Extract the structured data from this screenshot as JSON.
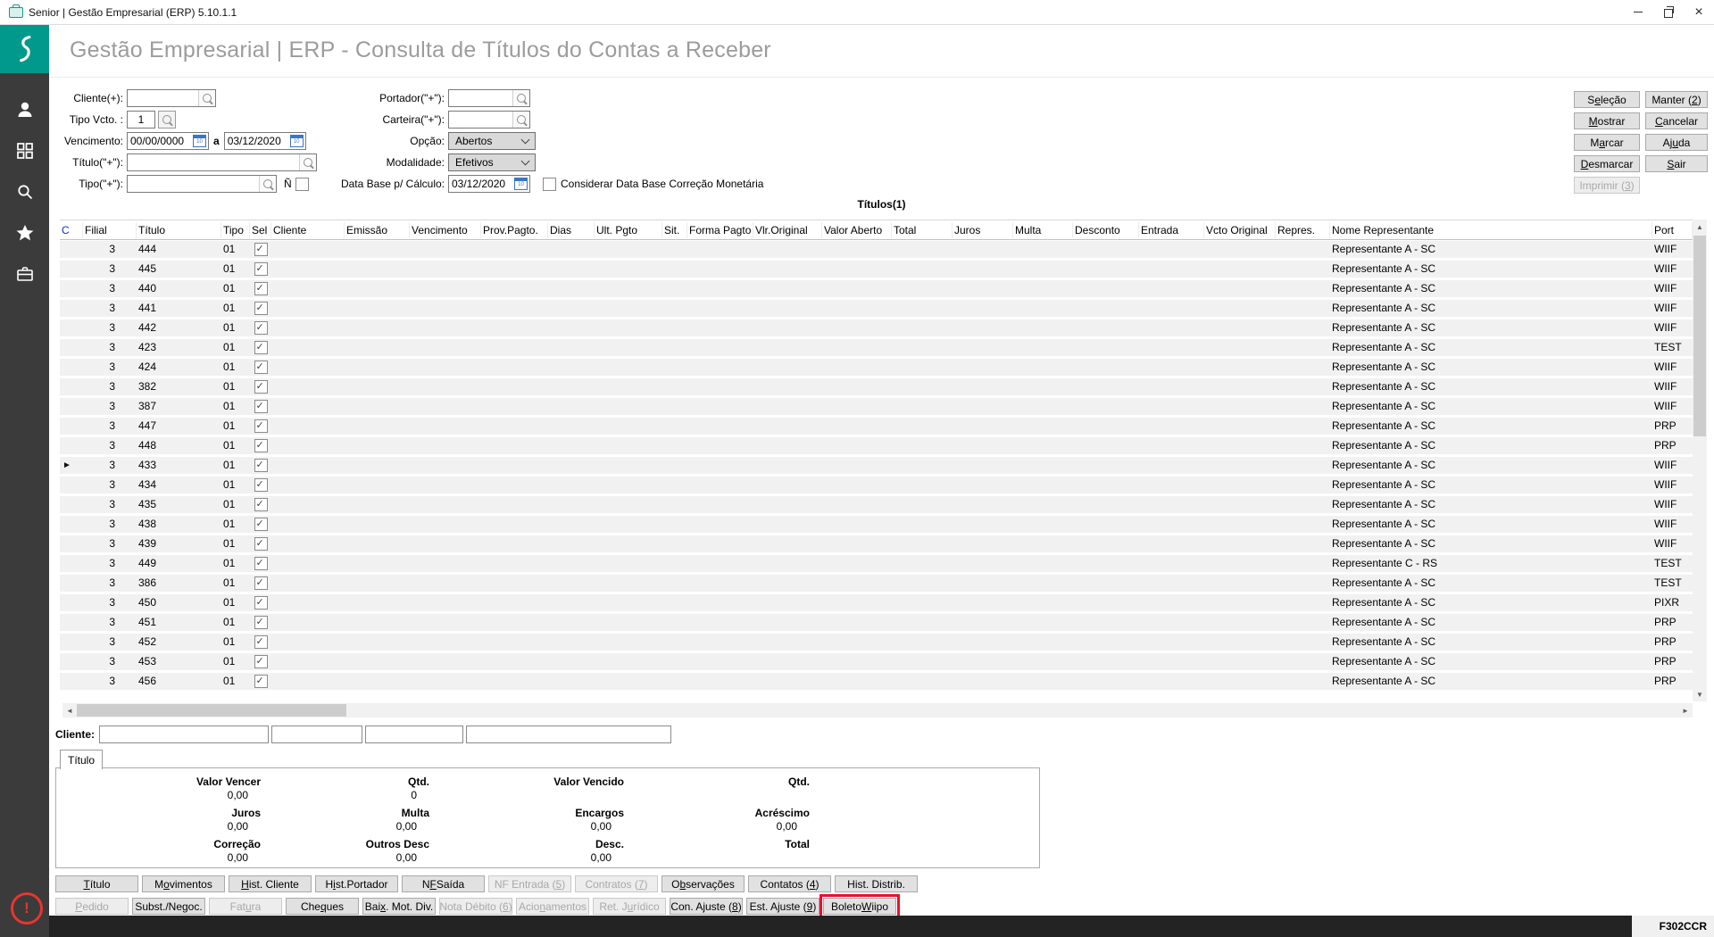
{
  "window": {
    "title": "Senior | Gestão Empresarial (ERP) 5.10.1.1",
    "controls": [
      "minimize-icon",
      "restore-icon",
      "close-icon"
    ]
  },
  "sidebar": {
    "brand_icon": "senior-logo",
    "icons": [
      "user",
      "apps-grid",
      "search",
      "star",
      "briefcase"
    ],
    "alert": "!"
  },
  "header": {
    "title": "Gestão Empresarial | ERP - Consulta de Títulos do Contas a Receber"
  },
  "filters": {
    "cliente_label": "Cliente(+):",
    "tipo_vcto_label": "Tipo Vcto. :",
    "tipo_vcto_value": "1",
    "vencimento_label": "Vencimento:",
    "vencimento_from": "00/00/0000",
    "range_sep": "a",
    "vencimento_to": "03/12/2020",
    "titulo_label": "Título(\"+\"):",
    "tipo_label": "Tipo(\"+\"):",
    "n_label": "Ñ",
    "portador_label": "Portador(\"+\"):",
    "carteira_label": "Carteira(\"+\"):",
    "opcao_label": "Opção:",
    "opcao_value": "Abertos",
    "modalidade_label": "Modalidade:",
    "modalidade_value": "Efetivos",
    "database_label": "Data Base p/ Cálculo:",
    "database_value": "03/12/2020",
    "considerar_label": "Considerar Data Base Correção Monetária"
  },
  "right_buttons": [
    {
      "html": "S<u>e</u>leção"
    },
    {
      "html": "Manter (<u>2</u>)"
    },
    {
      "html": "<u>M</u>ostrar"
    },
    {
      "html": "<u>C</u>ancelar"
    },
    {
      "html": "M<u>a</u>rcar"
    },
    {
      "html": "Aj<u>u</u>da"
    },
    {
      "html": "<u>D</u>esmarcar"
    },
    {
      "html": "<u>S</u>air"
    },
    {
      "html": "Imprimir (<u>3</u>)",
      "disabled": true
    }
  ],
  "caption": "Títulos(1)",
  "table": {
    "headers": [
      {
        "label": "C",
        "cls": "hl"
      },
      {
        "label": "Filial"
      },
      {
        "label": "Título"
      },
      {
        "label": "Tipo"
      },
      {
        "label": "Sel"
      },
      {
        "label": "Cliente"
      },
      {
        "label": "Emissão"
      },
      {
        "label": "Vencimento"
      },
      {
        "label": "Prov.Pagto."
      },
      {
        "label": "Dias"
      },
      {
        "label": "Ult. Pgto"
      },
      {
        "label": "Sit."
      },
      {
        "label": "Forma Pagto"
      },
      {
        "label": "Vlr.Original"
      },
      {
        "label": "Valor Aberto"
      },
      {
        "label": "Total"
      },
      {
        "label": "Juros"
      },
      {
        "label": "Multa"
      },
      {
        "label": "Desconto"
      },
      {
        "label": "Entrada"
      },
      {
        "label": "Vcto Original"
      },
      {
        "label": "Repres."
      },
      {
        "label": "Nome Representante"
      },
      {
        "label": "Port"
      }
    ],
    "rows": [
      {
        "filial": "3",
        "titulo": "444",
        "tipo": "01",
        "checked": true,
        "nome": "Representante A - SC",
        "port": "WIIF"
      },
      {
        "filial": "3",
        "titulo": "445",
        "tipo": "01",
        "checked": true,
        "nome": "Representante A - SC",
        "port": "WIIF"
      },
      {
        "filial": "3",
        "titulo": "440",
        "tipo": "01",
        "checked": true,
        "nome": "Representante A - SC",
        "port": "WIIF"
      },
      {
        "filial": "3",
        "titulo": "441",
        "tipo": "01",
        "checked": true,
        "nome": "Representante A - SC",
        "port": "WIIF"
      },
      {
        "filial": "3",
        "titulo": "442",
        "tipo": "01",
        "checked": true,
        "nome": "Representante A - SC",
        "port": "WIIF"
      },
      {
        "filial": "3",
        "titulo": "423",
        "tipo": "01",
        "checked": true,
        "nome": "Representante A - SC",
        "port": "TEST"
      },
      {
        "filial": "3",
        "titulo": "424",
        "tipo": "01",
        "checked": true,
        "nome": "Representante A - SC",
        "port": "WIIF"
      },
      {
        "filial": "3",
        "titulo": "382",
        "tipo": "01",
        "checked": true,
        "nome": "Representante A - SC",
        "port": "WIIF"
      },
      {
        "filial": "3",
        "titulo": "387",
        "tipo": "01",
        "checked": true,
        "nome": "Representante A - SC",
        "port": "WIIF"
      },
      {
        "filial": "3",
        "titulo": "447",
        "tipo": "01",
        "checked": true,
        "nome": "Representante A - SC",
        "port": "PRP"
      },
      {
        "filial": "3",
        "titulo": "448",
        "tipo": "01",
        "checked": true,
        "nome": "Representante A - SC",
        "port": "PRP"
      },
      {
        "filial": "3",
        "titulo": "433",
        "tipo": "01",
        "checked": true,
        "nome": "Representante A - SC",
        "port": "WIIF",
        "selected": true
      },
      {
        "filial": "3",
        "titulo": "434",
        "tipo": "01",
        "checked": true,
        "nome": "Representante A - SC",
        "port": "WIIF"
      },
      {
        "filial": "3",
        "titulo": "435",
        "tipo": "01",
        "checked": true,
        "nome": "Representante A - SC",
        "port": "WIIF"
      },
      {
        "filial": "3",
        "titulo": "438",
        "tipo": "01",
        "checked": true,
        "nome": "Representante A - SC",
        "port": "WIIF"
      },
      {
        "filial": "3",
        "titulo": "439",
        "tipo": "01",
        "checked": true,
        "nome": "Representante A - SC",
        "port": "WIIF"
      },
      {
        "filial": "3",
        "titulo": "449",
        "tipo": "01",
        "checked": true,
        "nome": "Representante C - RS",
        "port": "TEST"
      },
      {
        "filial": "3",
        "titulo": "386",
        "tipo": "01",
        "checked": true,
        "nome": "Representante A - SC",
        "port": "TEST"
      },
      {
        "filial": "3",
        "titulo": "450",
        "tipo": "01",
        "checked": true,
        "nome": "Representante A - SC",
        "port": "PIXR"
      },
      {
        "filial": "3",
        "titulo": "451",
        "tipo": "01",
        "checked": true,
        "nome": "Representante A - SC",
        "port": "PRP"
      },
      {
        "filial": "3",
        "titulo": "452",
        "tipo": "01",
        "checked": true,
        "nome": "Representante A - SC",
        "port": "PRP"
      },
      {
        "filial": "3",
        "titulo": "453",
        "tipo": "01",
        "checked": true,
        "nome": "Representante A - SC",
        "port": "PRP"
      },
      {
        "filial": "3",
        "titulo": "456",
        "tipo": "01",
        "checked": true,
        "nome": "Representante A - SC",
        "port": "PRP"
      }
    ]
  },
  "cliente_footer": {
    "label": "Cliente:"
  },
  "tab": {
    "label": "Título"
  },
  "summary": {
    "cells": [
      {
        "label": "Valor Vencer",
        "value": "0,00"
      },
      {
        "label": "Qtd.",
        "value": "0"
      },
      {
        "label": "Valor Vencido",
        "value": ""
      },
      {
        "label": "Qtd.",
        "value": ""
      },
      {
        "label": "Juros",
        "value": "0,00"
      },
      {
        "label": "Multa",
        "value": "0,00"
      },
      {
        "label": "Encargos",
        "value": "0,00"
      },
      {
        "label": "Acréscimo",
        "value": "0,00"
      },
      {
        "label": "Correção",
        "value": "0,00"
      },
      {
        "label": "Outros Desc",
        "value": "0,00"
      },
      {
        "label": "Desc.",
        "value": "0,00"
      },
      {
        "label": "Total",
        "value": ""
      }
    ]
  },
  "bottom_buttons": {
    "row1": [
      {
        "html": "<u>T</u>ítulo"
      },
      {
        "html": "M<u>o</u>vimentos"
      },
      {
        "html": "<u>H</u>ist. Cliente"
      },
      {
        "html": "H<u>i</u>st.Portador"
      },
      {
        "html": "N<u>F</u> Saída"
      },
      {
        "html": "NF Entrada (<u>5</u>)",
        "disabled": true
      },
      {
        "html": "Contratos (<u>7</u>)",
        "disabled": true
      },
      {
        "html": "O<u>b</u>servações"
      },
      {
        "html": "Contatos (<u>4</u>)"
      },
      {
        "html": "Hist. Distrib."
      }
    ],
    "row2": [
      {
        "html": "<u>P</u>edido",
        "disabled": true
      },
      {
        "html": "Subst./Negoc."
      },
      {
        "html": "Fat<u>u</u>ra",
        "disabled": true
      },
      {
        "html": "Che<u>q</u>ues"
      },
      {
        "html": "Bai<u>x</u>. Mot. Div."
      },
      {
        "html": "Nota Débito (<u>6</u>)",
        "disabled": true
      },
      {
        "html": "Acio<u>n</u>amentos",
        "disabled": true
      },
      {
        "html": "Ret. J<u>u</u>rídico",
        "disabled": true
      },
      {
        "html": "Con. Ajuste (<u>8</u>)"
      },
      {
        "html": "Est. Ajuste (<u>9</u>)"
      },
      {
        "html": "Boleto <u>W</u>iipo",
        "highlighted": true
      }
    ]
  },
  "status": {
    "code": "F302CCR"
  },
  "colors": {
    "teal": "#00998c",
    "sidebar": "#3b3b3b",
    "highlight_red": "#e8112d",
    "row_bg": "#f1f1f1"
  }
}
